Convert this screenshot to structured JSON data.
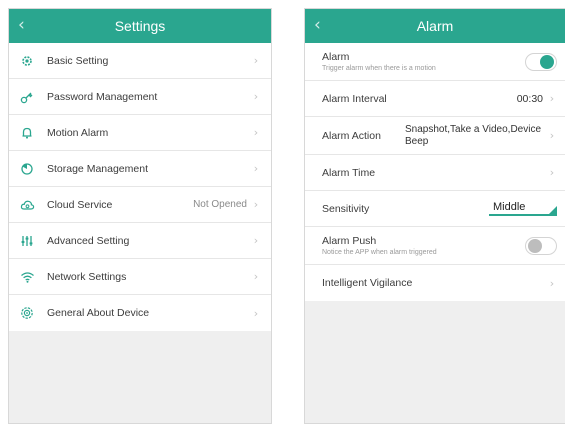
{
  "settings": {
    "title": "Settings",
    "back_glyph": "‹",
    "items": [
      {
        "label": "Basic Setting",
        "icon": "gear-icon",
        "value": ""
      },
      {
        "label": "Password Management",
        "icon": "key-icon",
        "value": ""
      },
      {
        "label": "Motion Alarm",
        "icon": "bell-icon",
        "value": ""
      },
      {
        "label": "Storage Management",
        "icon": "storage-icon",
        "value": ""
      },
      {
        "label": "Cloud Service",
        "icon": "cloud-icon",
        "value": "Not Opened"
      },
      {
        "label": "Advanced Setting",
        "icon": "sliders-icon",
        "value": ""
      },
      {
        "label": "Network Settings",
        "icon": "wifi-icon",
        "value": ""
      },
      {
        "label": "General About Device",
        "icon": "device-gear-icon",
        "value": ""
      }
    ]
  },
  "alarm": {
    "title": "Alarm",
    "back_glyph": "‹",
    "alarm_toggle": {
      "label": "Alarm",
      "sub": "Trigger alarm when there is a motion",
      "state": "on"
    },
    "interval": {
      "label": "Alarm Interval",
      "value": "00:30"
    },
    "action": {
      "label": "Alarm Action",
      "value": "Snapshot,Take a Video,Device Beep"
    },
    "time": {
      "label": "Alarm Time"
    },
    "sensitivity": {
      "label": "Sensitivity",
      "value": "Middle"
    },
    "push": {
      "label": "Alarm Push",
      "sub": "Notice the APP when alarm triggered",
      "state": "off"
    },
    "vigilance": {
      "label": "Intelligent Vigilance"
    }
  },
  "colors": {
    "accent": "#2aa68f",
    "icon": "#2aa68f"
  }
}
